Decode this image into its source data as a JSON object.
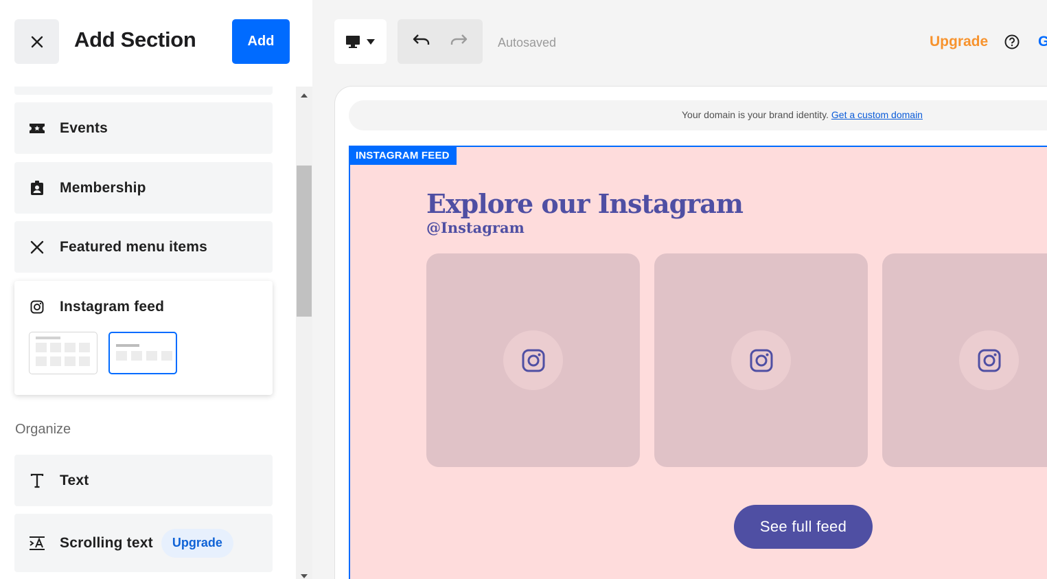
{
  "panel": {
    "title": "Add Section",
    "add_label": "Add",
    "close_icon": "close-icon"
  },
  "sections": [
    {
      "label": "Events",
      "icon": "ticket-icon"
    },
    {
      "label": "Membership",
      "icon": "badge-icon"
    },
    {
      "label": "Featured menu items",
      "icon": "utensils-icon"
    },
    {
      "label": "Instagram feed",
      "icon": "instagram-icon",
      "expanded": true,
      "layouts": [
        "grid",
        "row"
      ],
      "selected_layout": "row"
    }
  ],
  "organize": {
    "heading": "Organize",
    "items": [
      {
        "label": "Text",
        "icon": "text-icon"
      },
      {
        "label": "Scrolling text",
        "icon": "scrolling-text-icon",
        "badge": "Upgrade"
      }
    ]
  },
  "toolbar": {
    "device_icon": "desktop-icon",
    "undo_icon": "undo-icon",
    "redo_icon": "redo-icon",
    "autosaved": "Autosaved",
    "upgrade": "Upgrade",
    "help_icon": "help-icon",
    "truncated_right": "G"
  },
  "preview": {
    "domain_text": "Your domain is your brand identity.",
    "domain_link": "Get a custom domain",
    "section_tag": "INSTAGRAM FEED",
    "title": "Explore our Instagram",
    "handle": "@Instagram",
    "button": "See full feed"
  },
  "colors": {
    "accent": "#006bff",
    "upgrade": "#f7932e",
    "section_bg": "#fedcdc",
    "brand_text": "#4f4fa3",
    "tile_bg": "#e0c2c7"
  }
}
